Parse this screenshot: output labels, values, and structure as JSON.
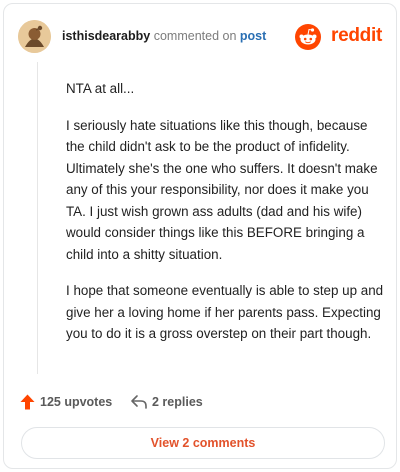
{
  "header": {
    "username": "isthisdearabby",
    "action": "commented on",
    "post_link": "post",
    "brand": "reddit"
  },
  "comment": {
    "paragraphs": [
      "NTA at all...",
      "I seriously hate situations like this though, because the child didn't ask to be the product of infidelity. Ultimately she's the one who suffers. It doesn't make any of this your responsibility, nor does it make you TA. I just wish grown ass adults (dad and his wife) would consider things like this BEFORE bringing a child into a shitty situation.",
      "I hope that someone eventually is able to step up and give her a loving home if her parents pass. Expecting you to do it is a gross overstep on their part though."
    ]
  },
  "footer": {
    "upvotes": "125 upvotes",
    "replies": "2 replies",
    "view_comments": "View 2 comments"
  },
  "colors": {
    "brand": "#ff4500",
    "upvote_arrow": "#ff4500",
    "link": "#2a6fb3",
    "button_text": "#e2522b"
  },
  "icons": {
    "avatar": "user-avatar",
    "brand": "reddit-logo-icon",
    "upvote": "upvote-arrow-icon",
    "reply": "reply-arrow-icon"
  }
}
